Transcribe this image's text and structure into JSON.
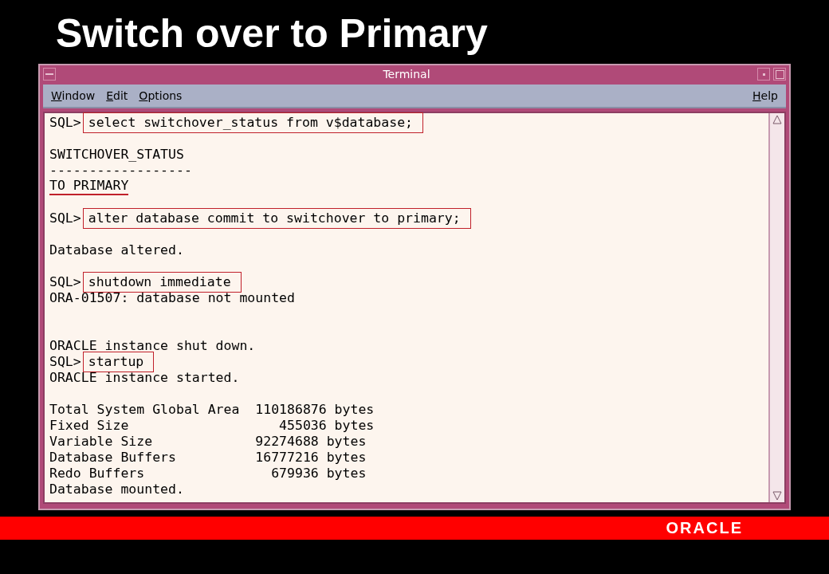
{
  "slide_title": "Switch over to Primary",
  "window": {
    "title": "Terminal"
  },
  "menu": [
    "Window",
    "Edit",
    "Options"
  ],
  "help_menu": "Help",
  "terminal_lines": [
    {
      "kind": "command",
      "prompt": "SQL>",
      "text": "select switchover_status from v$database;"
    },
    {
      "kind": "blank"
    },
    {
      "kind": "output",
      "text": "SWITCHOVER_STATUS"
    },
    {
      "kind": "output",
      "text": "------------------"
    },
    {
      "kind": "underlined",
      "text": "TO PRIMARY"
    },
    {
      "kind": "blank"
    },
    {
      "kind": "command",
      "prompt": "SQL>",
      "text": "alter database commit to switchover to primary;"
    },
    {
      "kind": "blank"
    },
    {
      "kind": "output",
      "text": "Database altered."
    },
    {
      "kind": "blank"
    },
    {
      "kind": "command",
      "prompt": "SQL>",
      "text": "shutdown immediate"
    },
    {
      "kind": "output",
      "text": "ORA-01507: database not mounted"
    },
    {
      "kind": "blank"
    },
    {
      "kind": "blank"
    },
    {
      "kind": "output",
      "text": "ORACLE instance shut down."
    },
    {
      "kind": "command",
      "prompt": "SQL>",
      "text": "startup"
    },
    {
      "kind": "output",
      "text": "ORACLE instance started."
    },
    {
      "kind": "blank"
    },
    {
      "kind": "output",
      "text": "Total System Global Area  110186876 bytes"
    },
    {
      "kind": "output",
      "text": "Fixed Size                   455036 bytes"
    },
    {
      "kind": "output",
      "text": "Variable Size             92274688 bytes"
    },
    {
      "kind": "output",
      "text": "Database Buffers          16777216 bytes"
    },
    {
      "kind": "output",
      "text": "Redo Buffers                679936 bytes"
    },
    {
      "kind": "output",
      "text": "Database mounted."
    }
  ],
  "footer": {
    "logo": "ORACLE"
  }
}
